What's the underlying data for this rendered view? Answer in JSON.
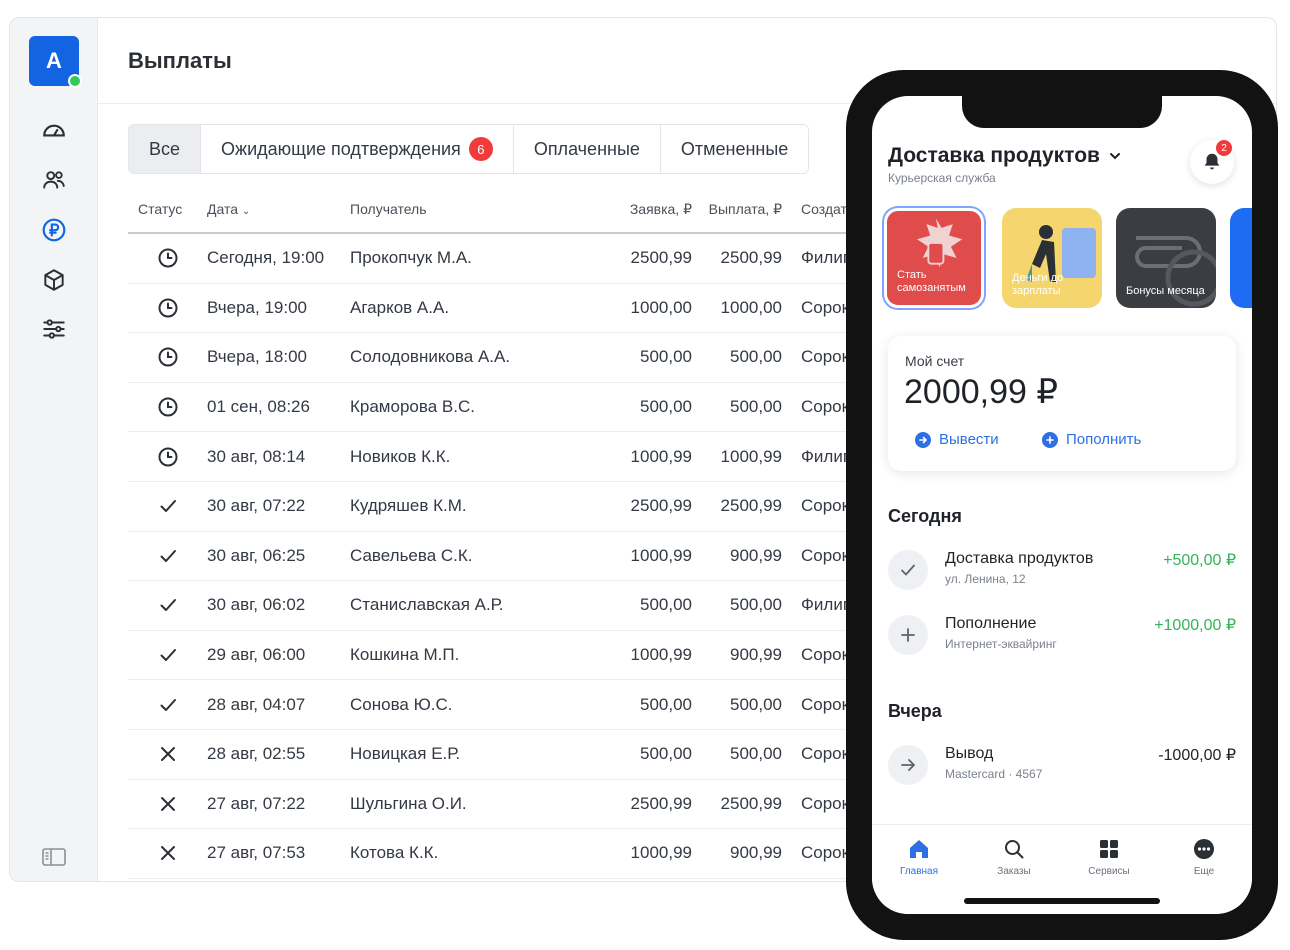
{
  "desktop": {
    "avatar_letter": "A",
    "page_title": "Выплаты",
    "nav_icons": [
      "dashboard-icon",
      "users-icon",
      "ruble-icon",
      "box-icon",
      "settings-sliders-icon"
    ],
    "tabs": [
      {
        "label": "Все",
        "active": true
      },
      {
        "label": "Ожидающие подтверждения",
        "badge": "6"
      },
      {
        "label": "Оплаченные"
      },
      {
        "label": "Отмененные"
      }
    ],
    "table": {
      "headers": {
        "status": "Статус",
        "date": "Дата",
        "recipient": "Получатель",
        "request": "Заявка, ₽",
        "payout": "Выплата, ₽",
        "creator": "Создате"
      },
      "rows": [
        {
          "status": "pending",
          "date": "Сегодня, 19:00",
          "recipient": "Прокопчук М.А.",
          "request": "2500,99",
          "payout": "2500,99",
          "creator": "Филиг"
        },
        {
          "status": "pending",
          "date": "Вчера, 19:00",
          "recipient": "Агарков А.А.",
          "request": "1000,00",
          "payout": "1000,00",
          "creator": "Сорок"
        },
        {
          "status": "pending",
          "date": "Вчера, 18:00",
          "recipient": "Солодовникова А.А.",
          "request": "500,00",
          "payout": "500,00",
          "creator": "Сорок"
        },
        {
          "status": "pending",
          "date": "01 сен, 08:26",
          "recipient": "Краморова В.С.",
          "request": "500,00",
          "payout": "500,00",
          "creator": "Сорок"
        },
        {
          "status": "pending",
          "date": "30 авг, 08:14",
          "recipient": "Новиков К.К.",
          "request": "1000,99",
          "payout": "1000,99",
          "creator": "Филиг"
        },
        {
          "status": "paid",
          "date": "30 авг, 07:22",
          "recipient": "Кудряшев К.М.",
          "request": "2500,99",
          "payout": "2500,99",
          "creator": "Сорок"
        },
        {
          "status": "paid",
          "date": "30 авг, 06:25",
          "recipient": "Савельева С.К.",
          "request": "1000,99",
          "payout": "900,99",
          "creator": "Сорок"
        },
        {
          "status": "paid",
          "date": "30 авг, 06:02",
          "recipient": "Станиславская А.Р.",
          "request": "500,00",
          "payout": "500,00",
          "creator": "Филиг"
        },
        {
          "status": "paid",
          "date": "29 авг, 06:00",
          "recipient": "Кошкина М.П.",
          "request": "1000,99",
          "payout": "900,99",
          "creator": "Сорок"
        },
        {
          "status": "paid",
          "date": "28 авг, 04:07",
          "recipient": "Сонова Ю.С.",
          "request": "500,00",
          "payout": "500,00",
          "creator": "Сорок"
        },
        {
          "status": "cancelled",
          "date": "28 авг, 02:55",
          "recipient": "Новицкая Е.Р.",
          "request": "500,00",
          "payout": "500,00",
          "creator": "Сорок"
        },
        {
          "status": "cancelled",
          "date": "27 авг, 07:22",
          "recipient": "Шульгина О.И.",
          "request": "2500,99",
          "payout": "2500,99",
          "creator": "Сорок"
        },
        {
          "status": "cancelled",
          "date": "27 авг, 07:53",
          "recipient": "Котова К.К.",
          "request": "1000,99",
          "payout": "900,99",
          "creator": "Сорок"
        }
      ]
    }
  },
  "phone": {
    "title": "Доставка продуктов",
    "subtitle": "Курьерская служба",
    "notif_count": "2",
    "stories": [
      {
        "text": "Стать самозанятым"
      },
      {
        "text": "Деньги до зарплаты"
      },
      {
        "text": "Бонусы месяца"
      },
      {
        "text": ""
      }
    ],
    "account": {
      "label": "Мой счет",
      "amount": "2000,99 ₽",
      "withdraw": "Вывести",
      "topup": "Пополнить"
    },
    "sections": [
      {
        "title": "Сегодня",
        "items": [
          {
            "icon": "check-icon",
            "title": "Доставка продуктов",
            "sub": "ул. Ленина, 12",
            "amount": "+500,00 ₽",
            "positive": true
          },
          {
            "icon": "plus-icon",
            "title": "Пополнение",
            "sub": "Интернет-эквайринг",
            "amount": "+1000,00 ₽",
            "positive": true
          }
        ]
      },
      {
        "title": "Вчера",
        "items": [
          {
            "icon": "arrow-right-icon",
            "title": "Вывод",
            "sub": "Mastercard · 4567",
            "amount": "-1000,00 ₽",
            "positive": false
          }
        ]
      }
    ],
    "tabbar": [
      {
        "label": "Главная",
        "icon": "home-icon",
        "active": true
      },
      {
        "label": "Заказы",
        "icon": "search-icon"
      },
      {
        "label": "Сервисы",
        "icon": "grid-icon"
      },
      {
        "label": "Еще",
        "icon": "more-icon"
      }
    ]
  },
  "colors": {
    "accent": "#1264e3",
    "link": "#2f6fe4",
    "positive": "#34b35a",
    "badge": "#ef3b3b",
    "online": "#34c759"
  }
}
